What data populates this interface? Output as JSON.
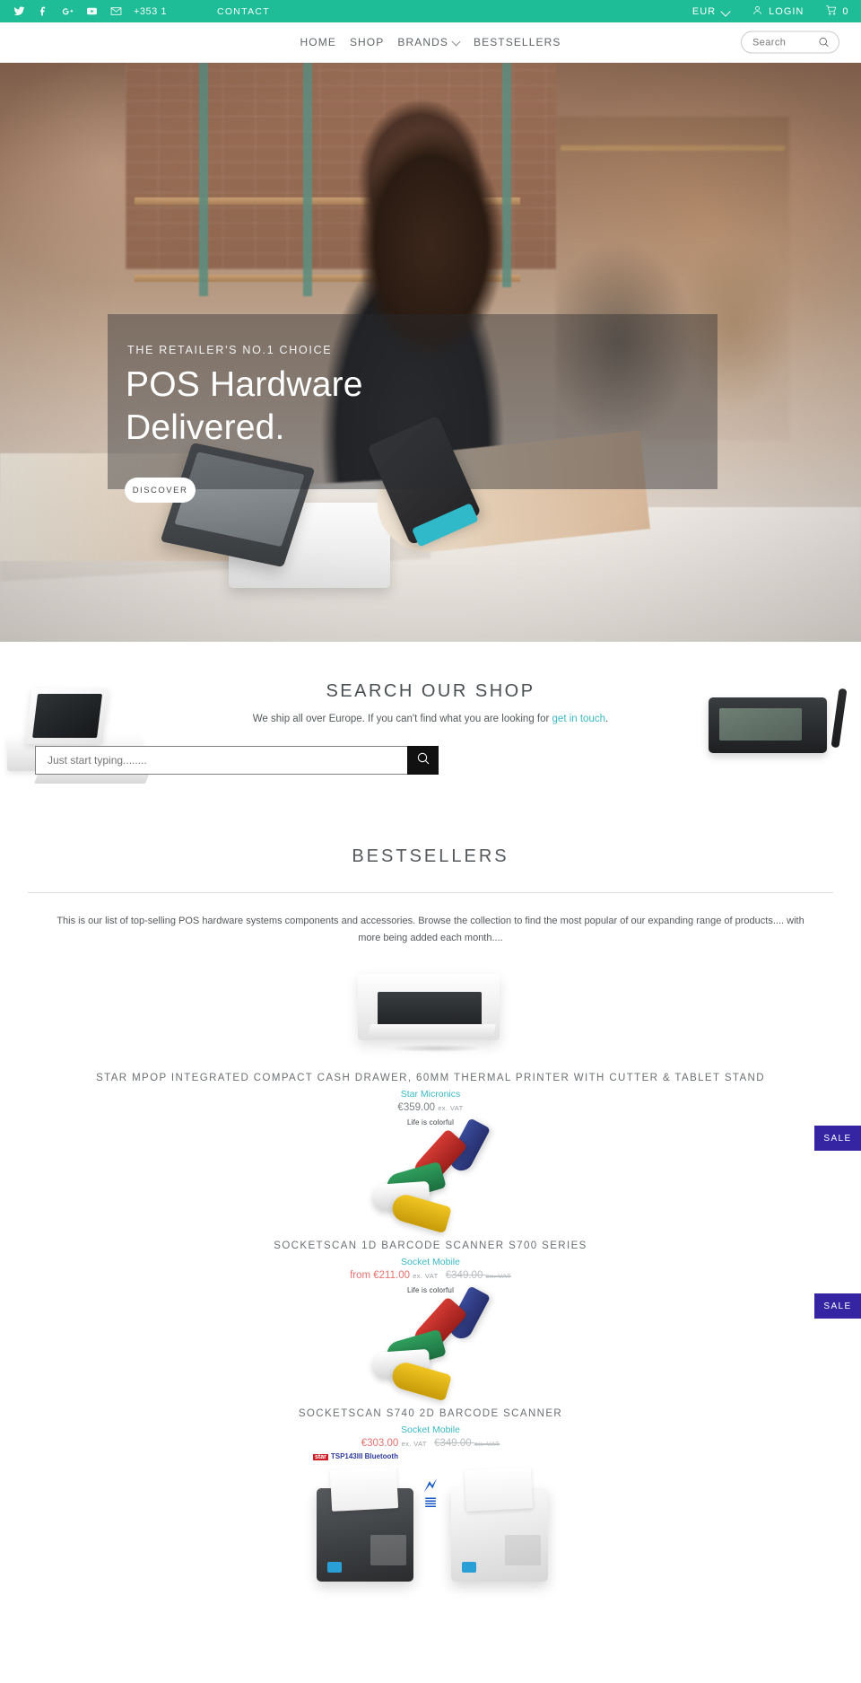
{
  "topbar": {
    "social": [
      {
        "name": "twitter-icon",
        "label": "Twitter"
      },
      {
        "name": "facebook-icon",
        "label": "Facebook"
      },
      {
        "name": "google-plus-icon",
        "label": "Google Plus"
      },
      {
        "name": "youtube-icon",
        "label": "YouTube"
      },
      {
        "name": "email-icon",
        "label": "Email"
      }
    ],
    "phone": "+353 1",
    "contact_label": "CONTACT",
    "currency": "EUR",
    "login_label": "LOGIN",
    "cart_count": "0",
    "background": "#1fbd97"
  },
  "nav": {
    "items": [
      {
        "label": "HOME",
        "has_caret": false
      },
      {
        "label": "SHOP",
        "has_caret": false
      },
      {
        "label": "BRANDS",
        "has_caret": true
      },
      {
        "label": "BESTSELLERS",
        "has_caret": false
      }
    ],
    "search_placeholder": "Search",
    "search_value": ""
  },
  "hero": {
    "eyebrow": "THE RETAILER'S NO.1 CHOICE",
    "title_line1": "POS Hardware",
    "title_line2": "Delivered.",
    "button_label": "DISCOVER"
  },
  "shop_search": {
    "title": "SEARCH OUR SHOP",
    "subtitle_before": "We ship all over Europe.  If you can't find what you are looking for ",
    "subtitle_link": "get in touch",
    "subtitle_after": ".",
    "input_placeholder": "Just start typing........",
    "input_value": "",
    "link_color": "#3cb8c4"
  },
  "bestsellers": {
    "title": "BESTSELLERS",
    "intro_line1": "This is our list of top-selling POS hardware systems components and accessories.  Browse the collection to find the most popular of our expanding range of products....",
    "intro_line2": "with more being added each month....",
    "sale_badge_label": "SALE",
    "sale_badge_color": "#3525a2",
    "products": [
      {
        "title": "STAR MPOP INTEGRATED COMPACT CASH DRAWER, 60MM THERMAL PRINTER WITH CUTTER & TABLET STAND",
        "vendor": "Star Micronics",
        "price": "€359.00",
        "price_suffix": "ex. VAT",
        "compare_price": "",
        "compare_suffix": "",
        "price_prefix": "",
        "on_sale": false,
        "image": "cash-drawer"
      },
      {
        "title": "SOCKETSCAN 1D BARCODE SCANNER S700 SERIES",
        "vendor": "Socket Mobile",
        "price": "€211.00",
        "price_suffix": "ex. VAT",
        "compare_price": "€349.00",
        "compare_suffix": "ex. VAT",
        "price_prefix": "from ",
        "on_sale": true,
        "image": "barcode-scanners",
        "image_caption": "Life is colorful"
      },
      {
        "title": "SOCKETSCAN S740 2D BARCODE SCANNER",
        "vendor": "Socket Mobile",
        "price": "€303.00",
        "price_suffix": "ex. VAT",
        "compare_price": "€349.00",
        "compare_suffix": "ex. VAT",
        "price_prefix": "",
        "on_sale": true,
        "image": "barcode-scanners",
        "image_caption": "Life is colorful"
      },
      {
        "title": "",
        "vendor": "",
        "price": "",
        "price_suffix": "",
        "compare_price": "",
        "compare_suffix": "",
        "price_prefix": "",
        "on_sale": false,
        "image": "thermal-printers",
        "image_caption": "TSP143III Bluetooth"
      }
    ]
  }
}
